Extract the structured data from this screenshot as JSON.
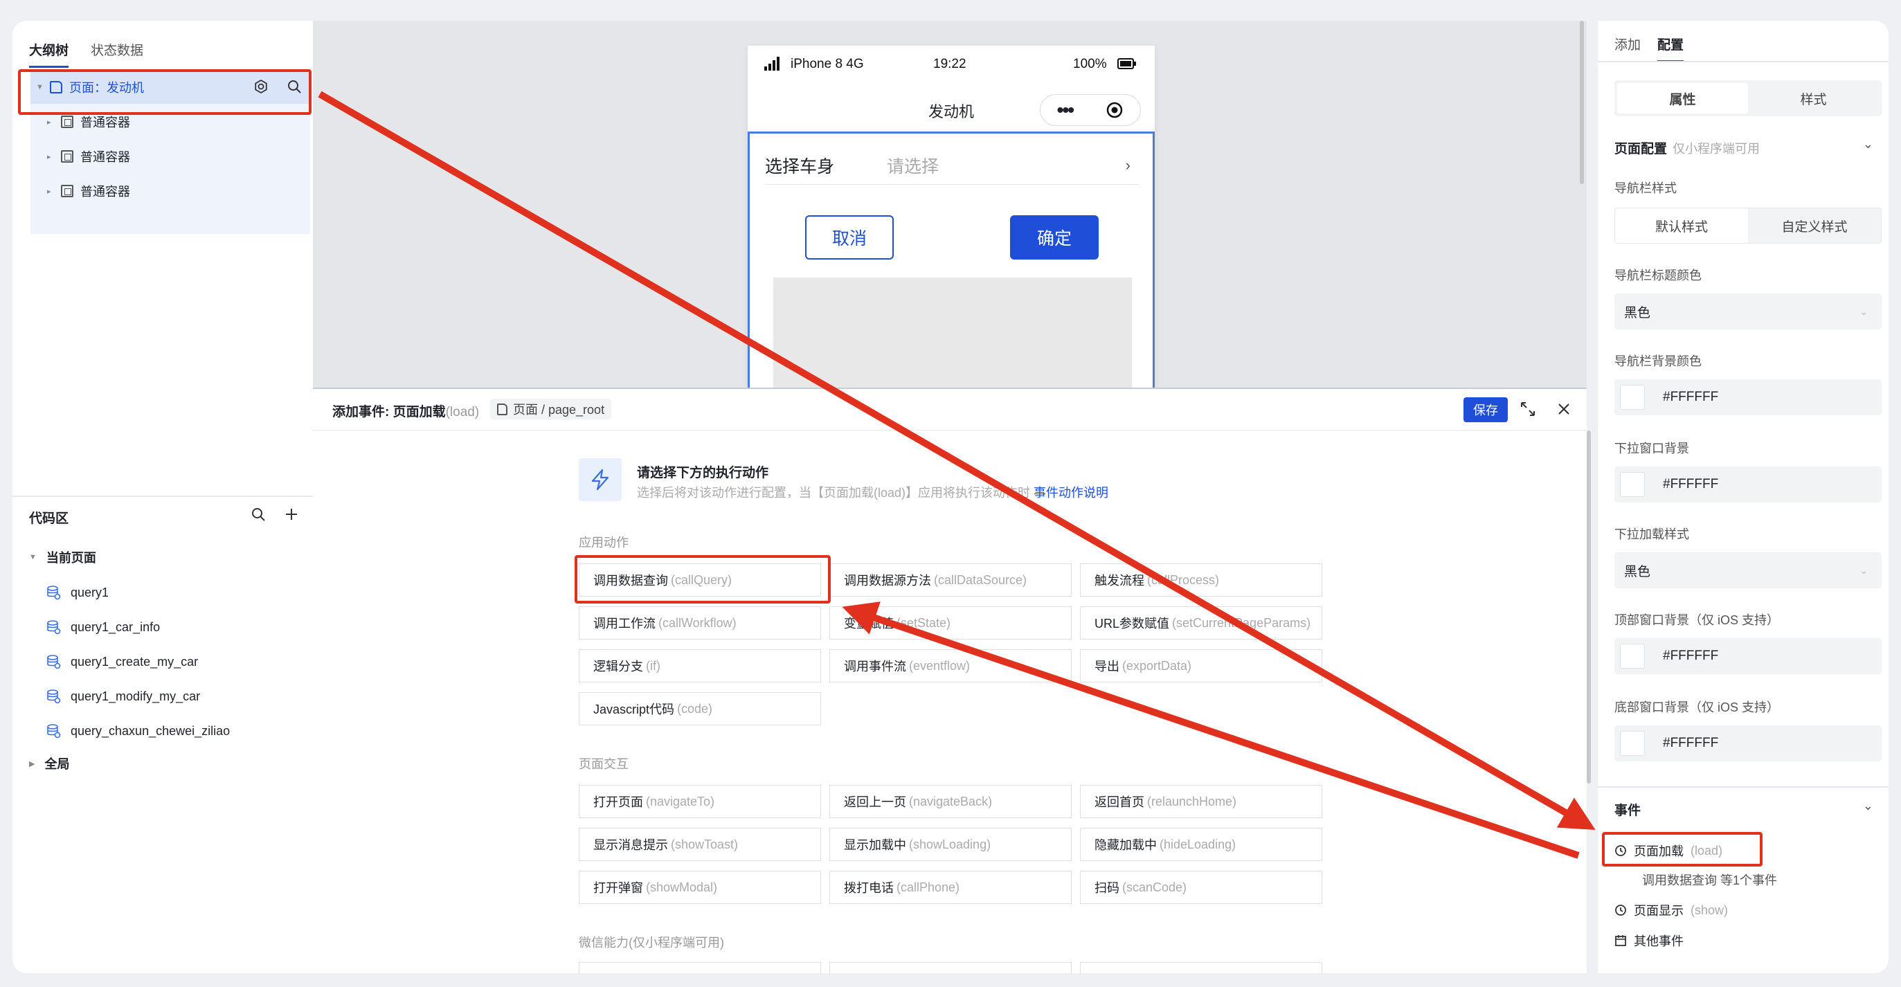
{
  "left": {
    "tabs": [
      "大纲树",
      "状态数据"
    ],
    "tree": {
      "root": "页面：发动机",
      "children": [
        "普通容器",
        "普通容器",
        "普通容器"
      ]
    },
    "code": {
      "title": "代码区",
      "current_page": "当前页面",
      "queries": [
        "query1",
        "query1_car_info",
        "query1_create_my_car",
        "query1_modify_my_car",
        "query_chaxun_chewei_ziliao"
      ],
      "global": "全局"
    }
  },
  "phone": {
    "carrier": "iPhone 8  4G",
    "time": "19:22",
    "battery": "100%",
    "title": "发动机",
    "select_label": "选择车身",
    "select_placeholder": "请选择",
    "cancel": "取消",
    "confirm": "确定"
  },
  "event": {
    "title": "添加事件: 页面加载",
    "title_en": "(load)",
    "crumb": "页面 / page_root",
    "save": "保存",
    "tip_title": "请选择下方的执行动作",
    "tip_desc": "选择后将对该动作进行配置，当【页面加载(load)】应用将执行该动作时",
    "tip_link": "事件动作说明",
    "sections": {
      "app": "应用动作",
      "page": "页面交互",
      "wechat": "微信能力(仅小程序端可用)"
    },
    "actions": [
      {
        "zh": "调用数据查询",
        "en": "(callQuery)"
      },
      {
        "zh": "调用数据源方法",
        "en": "(callDataSource)"
      },
      {
        "zh": "触发流程",
        "en": "(callProcess)"
      },
      {
        "zh": "调用工作流",
        "en": "(callWorkflow)"
      },
      {
        "zh": "变量赋值",
        "en": "(setState)"
      },
      {
        "zh": "URL参数赋值",
        "en": "(setCurrentPageParams)"
      },
      {
        "zh": "逻辑分支",
        "en": "(if)"
      },
      {
        "zh": "调用事件流",
        "en": "(eventflow)"
      },
      {
        "zh": "导出",
        "en": "(exportData)"
      },
      {
        "zh": "Javascript代码",
        "en": "(code)"
      }
    ],
    "page_actions": [
      {
        "zh": "打开页面",
        "en": "(navigateTo)"
      },
      {
        "zh": "返回上一页",
        "en": "(navigateBack)"
      },
      {
        "zh": "返回首页",
        "en": "(relaunchHome)"
      },
      {
        "zh": "显示消息提示",
        "en": "(showToast)"
      },
      {
        "zh": "显示加载中",
        "en": "(showLoading)"
      },
      {
        "zh": "隐藏加载中",
        "en": "(hideLoading)"
      },
      {
        "zh": "打开弹窗",
        "en": "(showModal)"
      },
      {
        "zh": "拨打电话",
        "en": "(callPhone)"
      },
      {
        "zh": "扫码",
        "en": "(scanCode)"
      }
    ]
  },
  "right": {
    "tabs": [
      "添加",
      "配置"
    ],
    "seg_main": [
      "属性",
      "样式"
    ],
    "page_config": "页面配置",
    "page_config_note": "仅小程序端可用",
    "nav_style_label": "导航栏样式",
    "nav_style": [
      "默认样式",
      "自定义样式"
    ],
    "nav_title_color_label": "导航栏标题颜色",
    "nav_title_color": "黑色",
    "nav_bg_color_label": "导航栏背景颜色",
    "nav_bg_color": "#FFFFFF",
    "pull_bg_label": "下拉窗口背景",
    "pull_bg": "#FFFFFF",
    "pull_load_label": "下拉加载样式",
    "pull_load": "黑色",
    "top_bg_label": "顶部窗口背景（仅 iOS 支持）",
    "top_bg": "#FFFFFF",
    "bottom_bg_label": "底部窗口背景（仅 iOS 支持）",
    "bottom_bg": "#FFFFFF",
    "events_title": "事件",
    "event_load": "页面加载",
    "event_load_en": "(load)",
    "event_load_note": "调用数据查询 等1个事件",
    "event_show": "页面显示",
    "event_show_en": "(show)",
    "event_other": "其他事件"
  },
  "colors": {
    "accent": "#1f4fd8",
    "annotation": "#e0301e"
  }
}
